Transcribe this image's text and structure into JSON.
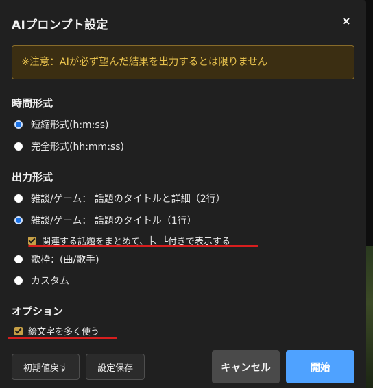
{
  "dialog": {
    "title": "AIプロンプト設定",
    "close_label": "×",
    "warning": "※注意：AIが必ず望んだ結果を出力するとは限りません"
  },
  "time_format": {
    "label": "時間形式",
    "options": [
      {
        "label": "短縮形式(h:m:ss)",
        "checked": true
      },
      {
        "label": "完全形式(hh:mm:ss)",
        "checked": false
      }
    ]
  },
  "output_format": {
    "label": "出力形式",
    "options": [
      {
        "label": "雑談/ゲーム： 話題のタイトルと詳細（2行）",
        "checked": false
      },
      {
        "label": "雑談/ゲーム： 話題のタイトル（1行）",
        "checked": true
      },
      {
        "label": "歌枠：(曲/歌手)",
        "checked": false
      },
      {
        "label": "カスタム",
        "checked": false
      }
    ],
    "sub_option": {
      "label": "関連する話題をまとめて、├、└付きで表示する",
      "checked": true
    }
  },
  "options": {
    "label": "オプション",
    "emoji": {
      "label": "絵文字を多く使う",
      "checked": true
    }
  },
  "buttons": {
    "reset": "初期値戻す",
    "save": "設定保存",
    "cancel": "キャンセル",
    "start": "開始"
  },
  "colors": {
    "accent_blue": "#4fa2ff",
    "warning_text": "#e7c14d",
    "checkbox_gold": "#c7a046",
    "annotation_red": "#d71e1e"
  }
}
